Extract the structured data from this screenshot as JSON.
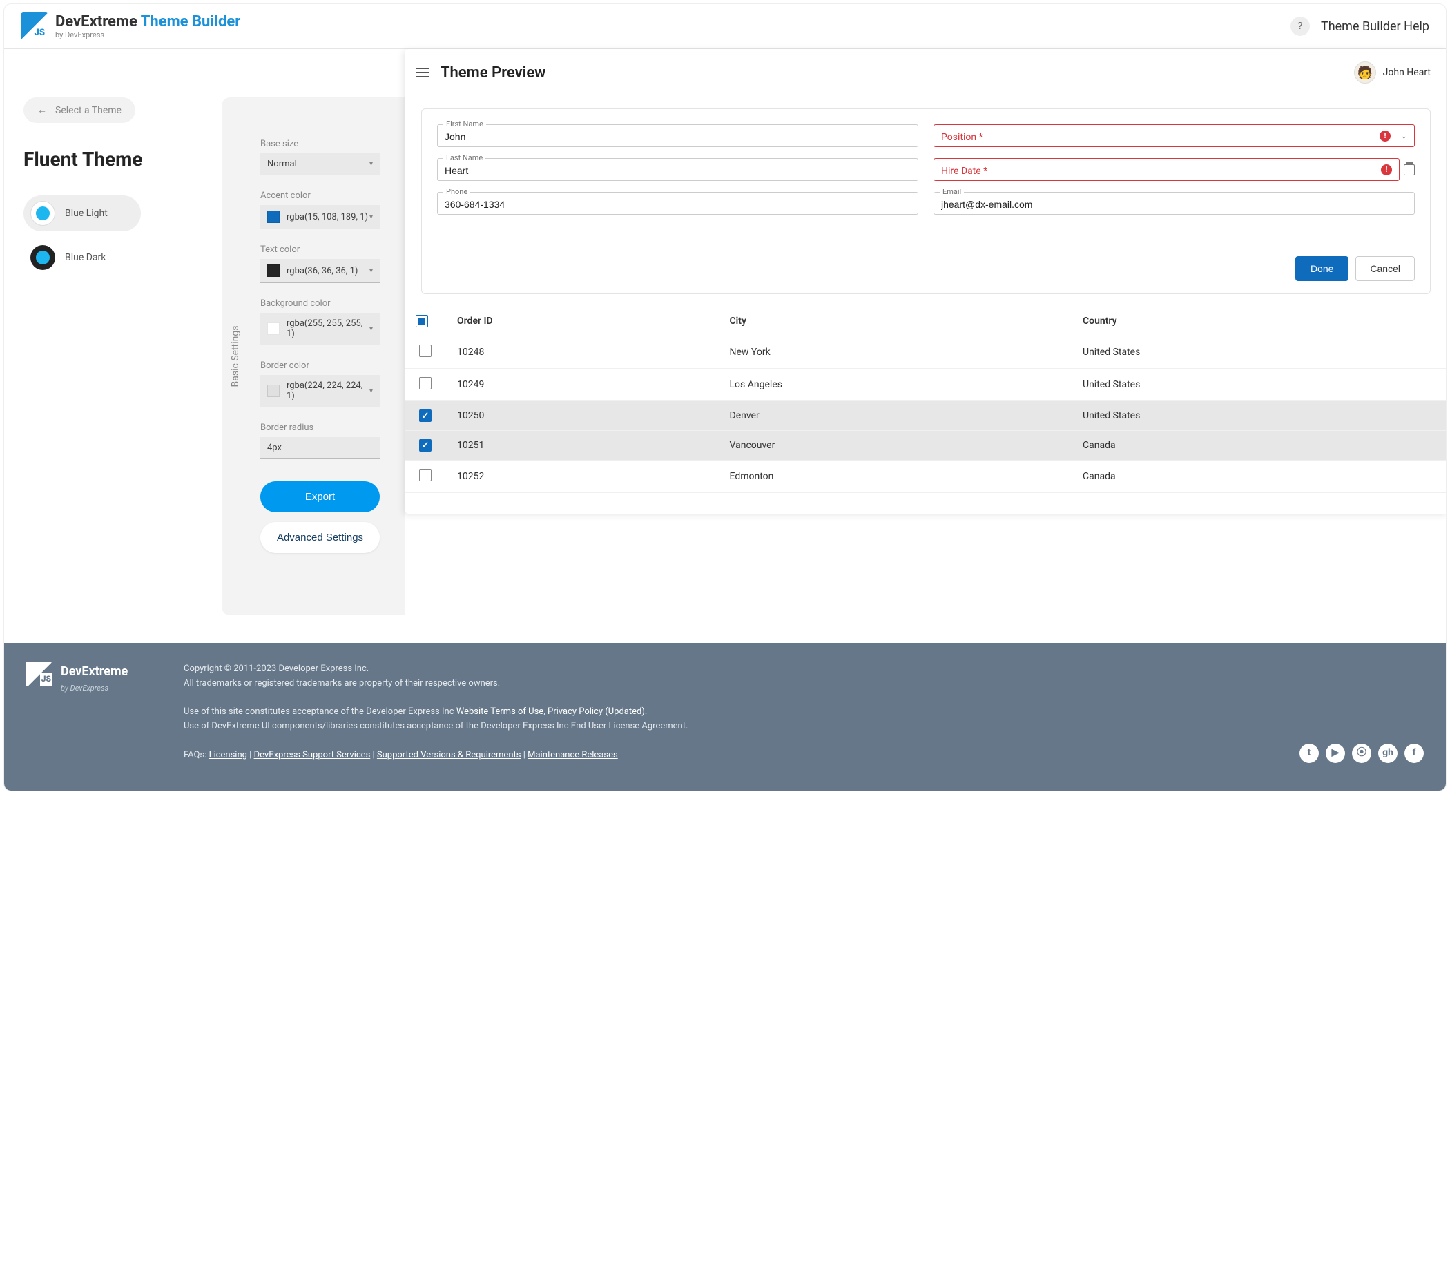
{
  "brand": {
    "name": "DevExtreme",
    "suffix": "Theme Builder",
    "by": "by DevExpress"
  },
  "header": {
    "help_link": "Theme Builder Help",
    "help_icon": "?"
  },
  "sidebar": {
    "back_label": "Select a Theme",
    "title": "Fluent Theme",
    "options": [
      {
        "label": "Blue Light",
        "active": true
      },
      {
        "label": "Blue Dark",
        "active": false
      }
    ]
  },
  "settings": {
    "vertical_label": "Basic Settings",
    "items": [
      {
        "label": "Base size",
        "value": "Normal",
        "swatch": null
      },
      {
        "label": "Accent color",
        "value": "rgba(15, 108, 189, 1)",
        "swatch": "#0f6cbd"
      },
      {
        "label": "Text color",
        "value": "rgba(36, 36, 36, 1)",
        "swatch": "#242424"
      },
      {
        "label": "Background color",
        "value": "rgba(255, 255, 255, 1)",
        "swatch": "#ffffff"
      },
      {
        "label": "Border color",
        "value": "rgba(224, 224, 224, 1)",
        "swatch": "#e0e0e0"
      },
      {
        "label": "Border radius",
        "value": "4px",
        "swatch": null
      }
    ],
    "export_label": "Export",
    "advanced_label": "Advanced Settings"
  },
  "preview": {
    "title": "Theme Preview",
    "user": "John Heart",
    "form": {
      "first_name": {
        "label": "First Name",
        "value": "John"
      },
      "last_name": {
        "label": "Last Name",
        "value": "Heart"
      },
      "phone": {
        "label": "Phone",
        "value": "360-684-1334"
      },
      "position": {
        "label": "Position *"
      },
      "hire_date": {
        "label": "Hire Date *"
      },
      "email": {
        "label": "Email",
        "value": "jheart@dx-email.com"
      }
    },
    "actions": {
      "done": "Done",
      "cancel": "Cancel"
    },
    "grid": {
      "columns": [
        "Order ID",
        "City",
        "Country"
      ],
      "rows": [
        {
          "order": "10248",
          "city": "New York",
          "country": "United States",
          "checked": false
        },
        {
          "order": "10249",
          "city": "Los Angeles",
          "country": "United States",
          "checked": false
        },
        {
          "order": "10250",
          "city": "Denver",
          "country": "United States",
          "checked": true
        },
        {
          "order": "10251",
          "city": "Vancouver",
          "country": "Canada",
          "checked": true
        },
        {
          "order": "10252",
          "city": "Edmonton",
          "country": "Canada",
          "checked": false
        }
      ]
    }
  },
  "footer": {
    "copyright": "Copyright © 2011-2023 Developer Express Inc.",
    "trademark": "All trademarks or registered trademarks are property of their respective owners.",
    "terms_pre": "Use of this site constitutes acceptance of the Developer Express Inc ",
    "terms1": "Website Terms of Use",
    "terms2": "Privacy Policy (Updated)",
    "eula": "Use of DevExtreme UI components/libraries constitutes acceptance of the Developer Express Inc End User License Agreement.",
    "faq_label": "FAQs:",
    "faq_links": [
      "Licensing",
      "DevExpress Support Services",
      "Supported Versions & Requirements",
      "Maintenance Releases"
    ]
  }
}
